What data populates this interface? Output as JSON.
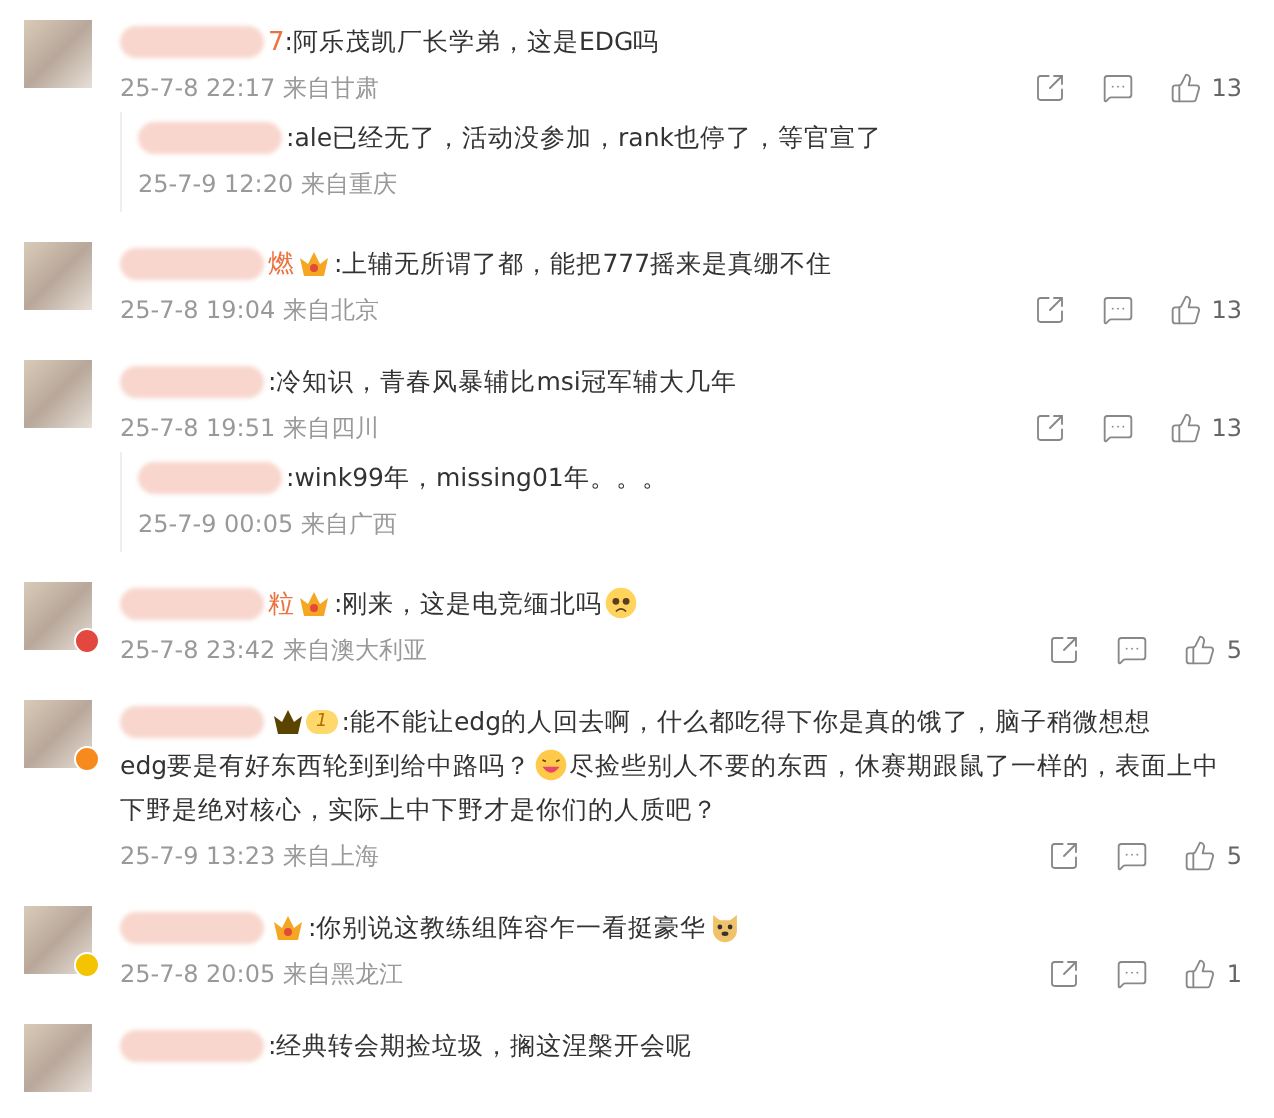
{
  "comments": [
    {
      "name_tail": "7",
      "text": [
        {
          "kind": "text",
          "text": ":阿乐茂凯厂长学弟，这是EDG吗"
        }
      ],
      "time": "25-7-8 22:17",
      "location": "来自甘肃",
      "likes": "13",
      "replies": [
        {
          "text": ":ale已经无了，活动没参加，rank也停了，等官宣了",
          "time": "25-7-9 12:20",
          "location": "来自重庆"
        }
      ]
    },
    {
      "name_tail": "燃",
      "badge": {
        "kind": "crown"
      },
      "text": [
        {
          "kind": "text",
          "text": ":上辅无所谓了都，能把777摇来是真绷不住"
        }
      ],
      "time": "25-7-8 19:04",
      "location": "来自北京",
      "likes": "13"
    },
    {
      "text": [
        {
          "kind": "text",
          "text": ":冷知识，青春风暴辅比msi冠军辅大几年"
        }
      ],
      "time": "25-7-8 19:51",
      "location": "来自四川",
      "likes": "13",
      "replies": [
        {
          "text": ":wink99年，missing01年。。。",
          "time": "25-7-9 00:05",
          "location": "来自广西"
        }
      ]
    },
    {
      "name_tail": "粒",
      "badge": {
        "kind": "crown"
      },
      "avatar_badge": {
        "color": "#e2483d"
      },
      "text": [
        {
          "kind": "text",
          "text": ":刚来，这是电竞缅北吗"
        },
        {
          "kind": "sad-face"
        }
      ],
      "time": "25-7-8 23:42",
      "location": "来自澳大利亚",
      "likes": "5"
    },
    {
      "badge": {
        "kind": "crown-level",
        "level": "1"
      },
      "avatar_badge": {
        "color": "#f78a1d"
      },
      "text": [
        {
          "kind": "text",
          "text": ":能不能让edg的人回去啊，什么都吃得下你是真的饿了，脑子稍微想想"
        },
        {
          "kind": "break"
        },
        {
          "kind": "text",
          "text": "edg要是有好东西轮到到给中路吗？"
        },
        {
          "kind": "grin-face"
        },
        {
          "kind": "text",
          "text": "尽捡些别人不要的东西，休赛期跟鼠了一样的，表面上中"
        },
        {
          "kind": "break"
        },
        {
          "kind": "text",
          "text": "下野是绝对核心，实际上中下野才是你们的人质吧？"
        }
      ],
      "time": "25-7-9 13:23",
      "location": "来自上海",
      "likes": "5"
    },
    {
      "badge": {
        "kind": "crown"
      },
      "avatar_badge": {
        "color": "#f5c400"
      },
      "text": [
        {
          "kind": "text",
          "text": ":你别说这教练组阵容乍一看挺豪华"
        },
        {
          "kind": "dog-face"
        }
      ],
      "time": "25-7-8 20:05",
      "location": "来自黑龙江",
      "likes": "1"
    },
    {
      "text": [
        {
          "kind": "text",
          "text": ":经典转会期捡垃圾，搁这涅槃开会呢"
        }
      ]
    }
  ]
}
